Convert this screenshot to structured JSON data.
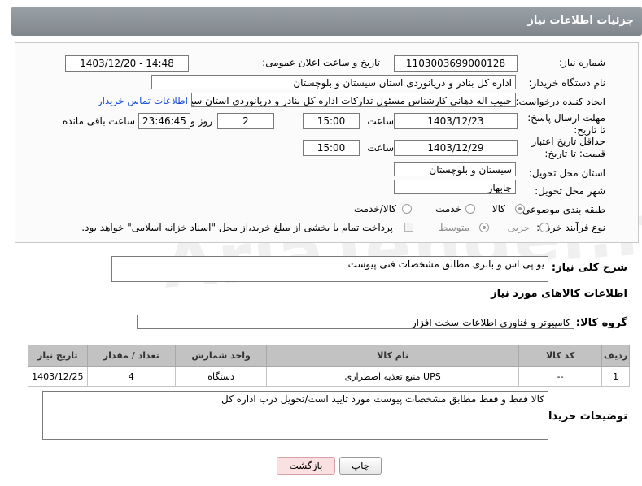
{
  "header": {
    "title": "جزئیات اطلاعات نیاز"
  },
  "form": {
    "need_number_label": "شماره نیاز:",
    "need_number": "1103003699000128",
    "announce_label": "تاریخ و ساعت اعلان عمومی:",
    "announce_value": "1403/12/20 - 14:48",
    "buyer_org_label": "نام دستگاه خریدار:",
    "buyer_org": "اداره کل بنادر و دریانوردی استان سیستان و بلوچستان",
    "creator_label": "ایجاد کننده درخواست:",
    "creator": "حبیب اله دهانی کارشناس مسئول تدارکات اداره کل بنادر و دریانوردی استان سیستان و بلوچستان",
    "contact_link": "اطلاعات تماس خریدار",
    "deadline_label": "مهلت ارسال پاسخ: تا تاریخ:",
    "deadline_date": "1403/12/23",
    "hour_label": "ساعت",
    "deadline_time": "15:00",
    "days_value": "2",
    "days_label": "روز و",
    "remaining_time": "23:46:45",
    "remaining_label": "ساعت باقی مانده",
    "validity_label": "حداقل تاریخ اعتبار قیمت: تا تاریخ:",
    "validity_date": "1403/12/29",
    "validity_hour_label": "ساعت",
    "validity_time": "15:00",
    "province_label": "استان محل تحویل:",
    "province": "سیستان و بلوچستان",
    "city_label": "شهر محل تحویل:",
    "city": "چابهار",
    "category_label": "طبقه بندی موضوعی:",
    "category_options": [
      "کالا",
      "خدمت",
      "کالا/خدمت"
    ],
    "purchase_label": "نوع فرآیند خرید :",
    "purchase_options": [
      "جزیی",
      "متوسط"
    ],
    "payment_note": "پرداخت تمام یا بخشی از مبلغ خرید،از محل \"اسناد خزانه اسلامی\" خواهد بود."
  },
  "summary": {
    "label": "شرح کلی نیاز:",
    "value": "یو پی اس و باتری مطابق مشخصات فنی پیوست"
  },
  "goods_section": {
    "title": "اطلاعات کالاهای مورد نیاز",
    "group_label": "گروه کالا:",
    "group_value": "کامپیوتر و فناوری اطلاعات-سخت افزار"
  },
  "table": {
    "headers": [
      "ردیف",
      "کد کالا",
      "نام کالا",
      "واحد شمارش",
      "تعداد / مقدار",
      "تاریخ نیاز"
    ],
    "rows": [
      {
        "row": "1",
        "code": "--",
        "name": "منبع تغذیه اضطراری UPS",
        "unit": "دستگاه",
        "qty": "4",
        "date": "1403/12/25"
      }
    ]
  },
  "notes": {
    "label": "توضیحات خریدار:",
    "value": "کالا فقط و فقط مطابق مشخصات پیوست مورد تایید است/تحویل درب اداره کل"
  },
  "buttons": {
    "print": "چاپ",
    "back": "بازگشت"
  },
  "watermark": "AriaTender.neT"
}
